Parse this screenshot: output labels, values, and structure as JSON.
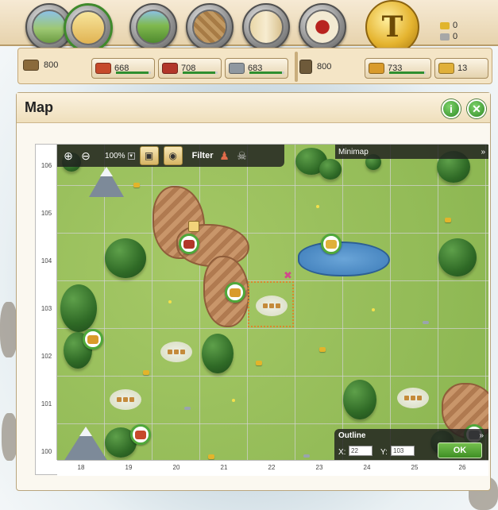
{
  "top_nav": {
    "buttons": [
      {
        "name": "landscape-view-icon"
      },
      {
        "name": "city-view-icon",
        "active": true
      },
      {
        "name": "fields-view-icon"
      },
      {
        "name": "map-scroll-icon"
      },
      {
        "name": "quest-scroll-icon"
      },
      {
        "name": "messages-seal-icon"
      }
    ],
    "coin_letter": "T",
    "mini_resources": [
      {
        "icon": "gold-bars-icon",
        "value": "0",
        "color": "#e1b52d"
      },
      {
        "icon": "silver-coins-icon",
        "value": "0",
        "color": "#a7a7a7"
      }
    ]
  },
  "resources": {
    "wood": {
      "value": "800",
      "color": "#8a6a3b"
    },
    "items": [
      {
        "icon": "planks-icon",
        "value": "668",
        "color": "#c64a2b",
        "fill": 0.94
      },
      {
        "icon": "bricks-icon",
        "value": "708",
        "color": "#b2362a",
        "fill": 0.94
      },
      {
        "icon": "iron-icon",
        "value": "683",
        "color": "#8f98a0",
        "fill": 0.94
      }
    ],
    "storage": {
      "value": "800",
      "color": "#6e5a3a"
    },
    "secondary": [
      {
        "icon": "grain-icon",
        "value": "733",
        "color": "#d99b2b",
        "fill": 0.95
      },
      {
        "icon": "wheat-icon",
        "value": "13",
        "color": "#e0b03a"
      }
    ]
  },
  "panel": {
    "title": "Map",
    "info_glyph": "i",
    "close_glyph": "✕"
  },
  "map": {
    "zoom": "100%",
    "filter_label": "Filter",
    "minimap_label": "Minimap",
    "expand_glyph": "»",
    "y_coords": [
      "106",
      "105",
      "104",
      "103",
      "102",
      "101",
      "100"
    ],
    "x_coords": [
      "18",
      "19",
      "20",
      "21",
      "22",
      "23",
      "24",
      "25",
      "26"
    ],
    "outline": {
      "title": "Outline",
      "x_label": "X:",
      "x_value": "22",
      "y_label": "Y:",
      "y_value": "103",
      "ok_label": "OK"
    }
  }
}
